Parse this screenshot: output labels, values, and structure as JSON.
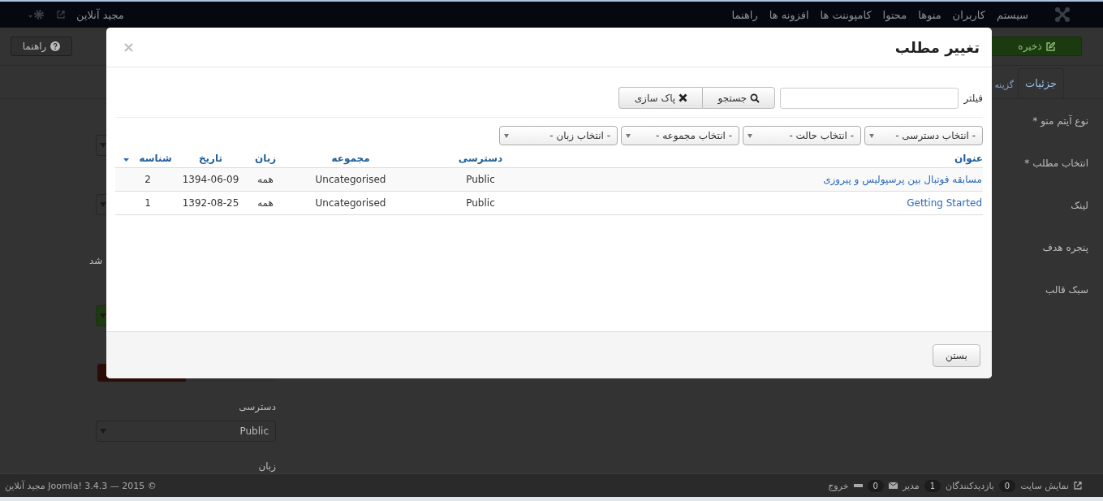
{
  "navbar": {
    "menu": [
      "سیستم",
      "کاربران",
      "منوها",
      "محتوا",
      "کامپوننت ها",
      "افزونه ها",
      "راهنما"
    ],
    "site_name": "مجید آنلاین"
  },
  "toolbar": {
    "save": "ذخیره",
    "help": "راهنما"
  },
  "tabs": [
    {
      "label": "جزئیات",
      "selected": true
    },
    {
      "label": "گزینه",
      "selected": false
    }
  ],
  "form": {
    "labels": [
      "نوع آیتم منو *",
      "انتخاب مطلب *",
      "لینک",
      "پنجره هدف",
      "سبک قالب"
    ],
    "cut_text": "شد",
    "access_label": "دسترسی",
    "access_value": "Public",
    "language_label": "زبان"
  },
  "modal": {
    "title": "تغییر مطلب",
    "filter_label": "فیلتر",
    "search_button": "جستجو",
    "clear_button": "پاک سازی",
    "selects": [
      "- انتخاب دسترسی -",
      "- انتخاب حالت -",
      "- انتخاب مجموعه -",
      "- انتخاب زبان -"
    ],
    "columns": [
      {
        "label": "عنوان",
        "sorted": false
      },
      {
        "label": "دسترسی",
        "sorted": false
      },
      {
        "label": "مجموعه",
        "sorted": false
      },
      {
        "label": "زبان",
        "sorted": false
      },
      {
        "label": "تاریخ",
        "sorted": false
      },
      {
        "label": "شناسه",
        "sorted": true
      }
    ],
    "rows": [
      [
        "مسابقه فوتبال بین پرسپولیس و پیروزی",
        "Public",
        "Uncategorised",
        "همه",
        "1394-06-09",
        "2"
      ],
      [
        "Getting Started",
        "Public",
        "Uncategorised",
        "همه",
        "1392-08-25",
        "1"
      ]
    ],
    "close_button": "بستن"
  },
  "status_bar": {
    "copyright": "© 2015 — Joomla! 3.4.3 مجید آنلاین",
    "view_site": "نمایش سایت",
    "visitors_count": "0",
    "visitors": "بازدیدکنندگان",
    "admins_count": "1",
    "admins": "مدیر",
    "messages_count": "0",
    "logout": "خروج"
  }
}
